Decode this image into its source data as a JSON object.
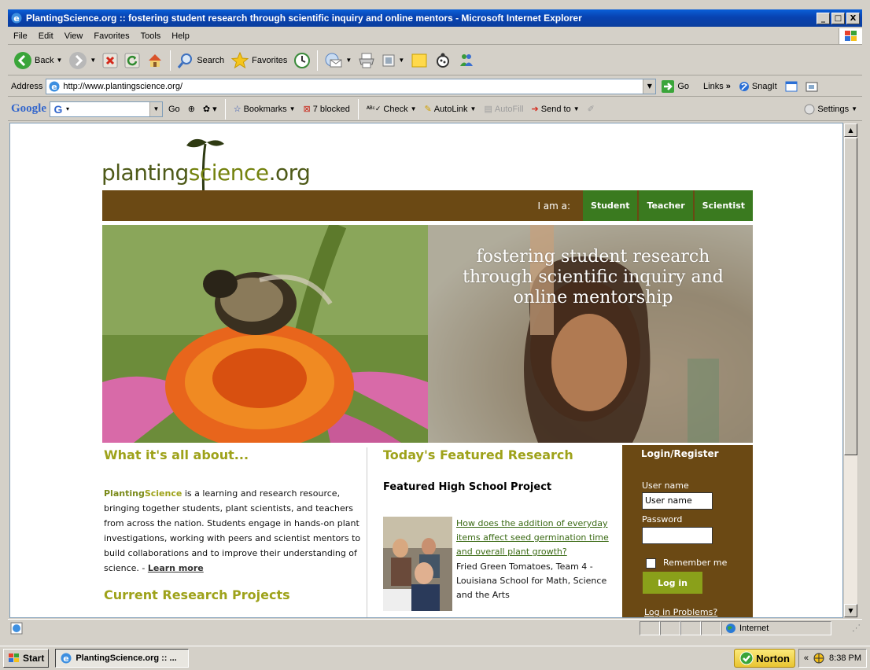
{
  "window": {
    "title": "PlantingScience.org :: fostering student research through scientific inquiry and online mentors - Microsoft Internet Explorer",
    "min_label": "_",
    "max_label": "□",
    "close_label": "X"
  },
  "menu": [
    "File",
    "Edit",
    "View",
    "Favorites",
    "Tools",
    "Help"
  ],
  "toolbar": {
    "back": "Back",
    "search": "Search",
    "favorites": "Favorites"
  },
  "address": {
    "label": "Address",
    "url": "http://www.plantingscience.org/",
    "go": "Go",
    "links": "Links",
    "links_chevron": "»",
    "snagit": "SnagIt"
  },
  "google_toolbar": {
    "logo": "Google",
    "go": "Go",
    "bookmarks": "Bookmarks",
    "blocked": "7 blocked",
    "check": "Check",
    "autolink": "AutoLink",
    "autofill": "AutoFill",
    "sendto": "Send to",
    "settings": "Settings"
  },
  "site": {
    "logo_part1": "planting",
    "logo_part2": "science",
    "logo_part3": ".org",
    "nav_prompt": "I am a:",
    "nav": [
      "Student",
      "Teacher",
      "Scientist"
    ],
    "tagline": "fostering student research through scientific inquiry and online mentorship",
    "about_heading": "What it's all about...",
    "about_brand_1": "Planting",
    "about_brand_2": "Science",
    "about_text": " is a learning and research resource, bringing together students, plant scientists, and teachers from across the nation. Students engage in hands-on plant investigations, working with peers and scientist mentors to build collaborations and to improve their understanding of science. - ",
    "learn_more": "Learn more",
    "current_heading": "Current Research Projects",
    "featured_heading": "Today's Featured Research",
    "featured_sub": "Featured High School Project",
    "featured_link": "How does the addition of everyday items affect seed germination time and overall plant growth?",
    "featured_desc": "Fried Green Tomatoes, Team 4 - Louisiana School for Math, Science and the Arts",
    "login": {
      "heading": "Login/Register",
      "username_label": "User name",
      "username_value": "User name",
      "password_label": "Password",
      "remember": "Remember me",
      "button": "Log in",
      "problems": "Log in Problems?"
    }
  },
  "status": {
    "zone": "Internet"
  },
  "taskbar": {
    "start": "Start",
    "task": "PlantingScience.org :: ...",
    "norton": "Norton",
    "tray_chevron": "«",
    "time": "8:38 PM"
  }
}
